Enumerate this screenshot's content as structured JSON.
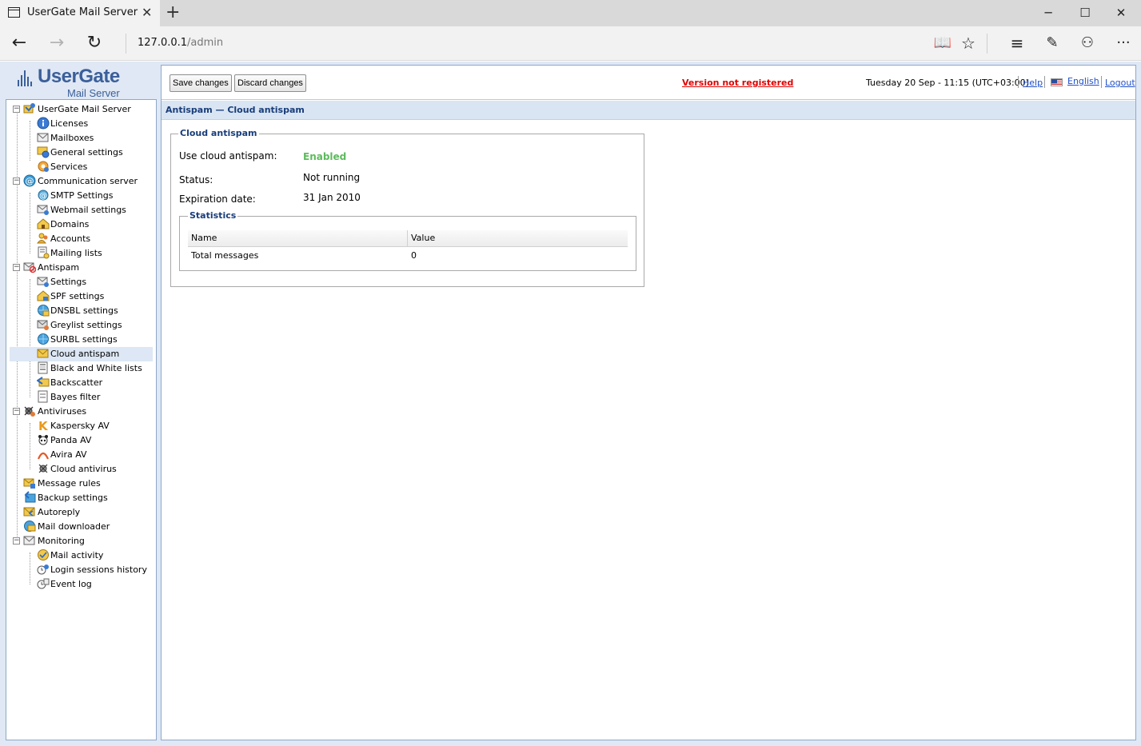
{
  "browser": {
    "tab_title": "UserGate Mail Server",
    "new_tab_icon": "plus-icon",
    "address_host": "127.0.0.1",
    "address_path": "/admin",
    "window_controls": [
      "minimize-icon",
      "maximize-icon",
      "close-icon"
    ],
    "nav_icons": [
      "back-arrow-icon",
      "forward-arrow-icon",
      "refresh-icon",
      "reading-view-icon",
      "favorite-star-icon",
      "hub-icon",
      "web-note-icon",
      "share-icon",
      "more-icon"
    ]
  },
  "logo": {
    "main": "UserGate",
    "sub": "Mail Server",
    "color": "#3b5f9a"
  },
  "tree": {
    "items": [
      {
        "label": "UserGate Mail Server"
      },
      {
        "label": "Licenses"
      },
      {
        "label": "Mailboxes"
      },
      {
        "label": "General settings"
      },
      {
        "label": "Services"
      },
      {
        "label": "Communication server"
      },
      {
        "label": "SMTP Settings"
      },
      {
        "label": "Webmail settings"
      },
      {
        "label": "Domains"
      },
      {
        "label": "Accounts"
      },
      {
        "label": "Mailing lists"
      },
      {
        "label": "Antispam"
      },
      {
        "label": "Settings"
      },
      {
        "label": "SPF settings"
      },
      {
        "label": "DNSBL settings"
      },
      {
        "label": "Greylist settings"
      },
      {
        "label": "SURBL settings"
      },
      {
        "label": "Cloud antispam"
      },
      {
        "label": "Black and White lists"
      },
      {
        "label": "Backscatter"
      },
      {
        "label": "Bayes filter"
      },
      {
        "label": "Antiviruses"
      },
      {
        "label": "Kaspersky AV"
      },
      {
        "label": "Panda AV"
      },
      {
        "label": "Avira AV"
      },
      {
        "label": "Cloud antivirus"
      },
      {
        "label": "Message rules"
      },
      {
        "label": "Backup settings"
      },
      {
        "label": "Autoreply"
      },
      {
        "label": "Mail downloader"
      },
      {
        "label": "Monitoring"
      },
      {
        "label": "Mail activity"
      },
      {
        "label": "Login sessions history"
      },
      {
        "label": "Event log"
      }
    ],
    "selected": "Cloud antispam"
  },
  "toolbar": {
    "save_label": "Save changes",
    "discard_label": "Discard changes",
    "unregistered": "Version not registered",
    "datetime": "Tuesday 20 Sep - 11:15 (UTC+03:00)",
    "help": "Help",
    "language": "English",
    "logout": "Logout"
  },
  "section": {
    "title": "Antispam — Cloud antispam"
  },
  "cloud_antispam": {
    "legend": "Cloud antispam",
    "use_label": "Use cloud antispam:",
    "use_value": "Enabled",
    "status_label": "Status:",
    "status_value": "Not running",
    "expiration_label": "Expiration date:",
    "expiration_value": "31 Jan 2010",
    "enabled_color": "#5cbb5c"
  },
  "statistics": {
    "legend": "Statistics",
    "columns": [
      "Name",
      "Value"
    ],
    "rows": [
      [
        "Total messages",
        "0"
      ]
    ]
  }
}
